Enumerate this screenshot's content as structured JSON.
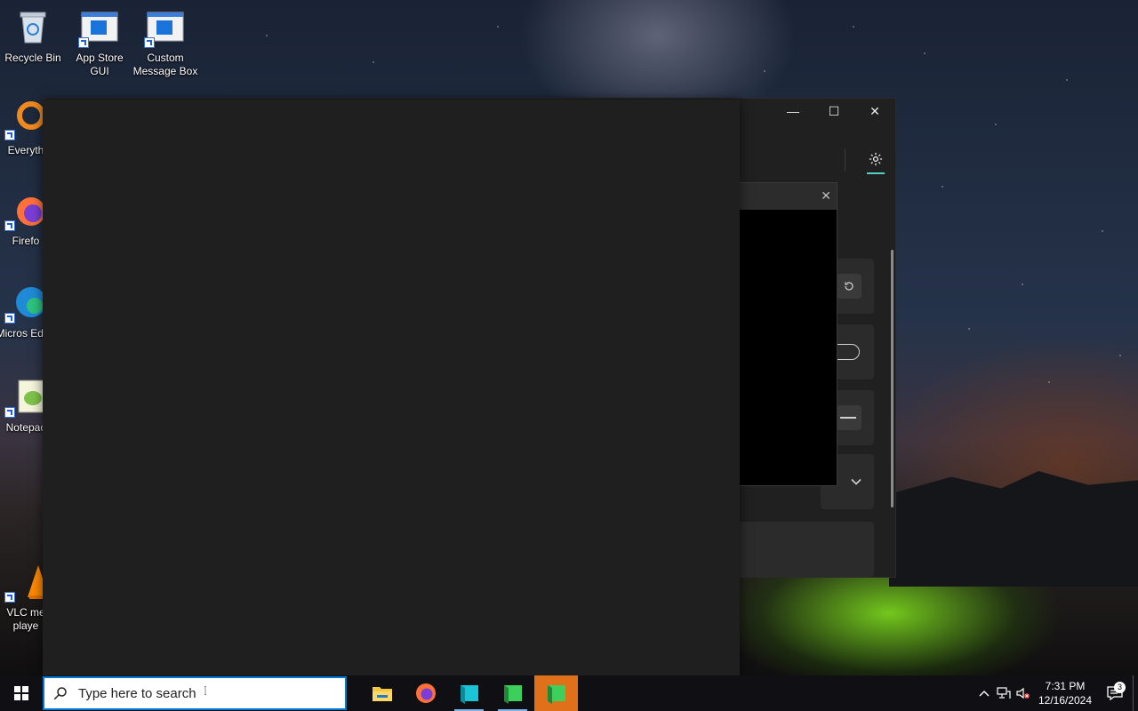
{
  "desktop": {
    "icons": [
      {
        "label": "Recycle Bin",
        "icon": "recycle-bin-icon"
      },
      {
        "label": "App Store GUI",
        "icon": "app-window-icon"
      },
      {
        "label": "Custom Message Box",
        "icon": "app-window-icon"
      },
      {
        "label": "Everyth",
        "icon": "everything-search-icon"
      },
      {
        "label": "Firefo",
        "icon": "firefox-icon"
      },
      {
        "label": "Micros Edge",
        "icon": "edge-icon"
      },
      {
        "label": "Notepac",
        "icon": "notepad-plus-icon"
      },
      {
        "label": "VLC me playe",
        "icon": "vlc-icon"
      }
    ]
  },
  "window": {
    "controls": {
      "minimize": "—",
      "maximize": "☐",
      "close": "✕"
    },
    "settings_icon": "gear-icon",
    "accent": "#4fd1c5"
  },
  "popup": {
    "close": "✕"
  },
  "taskbar": {
    "search_placeholder": "Type here to search",
    "apps": [
      "file-explorer-icon",
      "firefox-icon",
      "app-teal-icon",
      "app-green-icon",
      "app-green-active-icon"
    ],
    "clock_time": "7:31 PM",
    "clock_date": "12/16/2024",
    "notification_count": "3"
  }
}
